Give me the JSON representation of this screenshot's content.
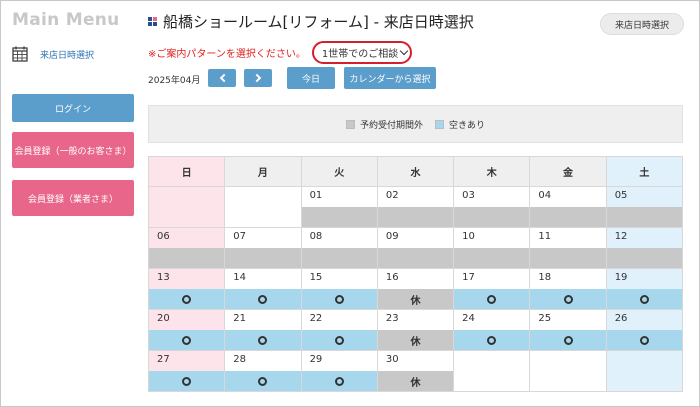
{
  "sidebar": {
    "menu_title": "Main Menu",
    "visit_link": "来店日時選択",
    "login": "ログイン",
    "register_general": "会員登録（一般のお客さま）",
    "register_business": "会員登録（業者さま）"
  },
  "header": {
    "title": "船橋ショールーム[リフォーム] - 来店日時選択",
    "badge": "来店日時選択",
    "pattern_notice": "※ご案内パターンを選択ください。",
    "pattern_selected": "1世帯でのご相談"
  },
  "nav": {
    "month": "2025年04月",
    "today": "今日",
    "pick_calendar": "カレンダーから選択"
  },
  "legend": {
    "closed_label": "予約受付期間外",
    "open_label": "空きあり"
  },
  "colors": {
    "accent_blue": "#5b9dcb",
    "accent_pink": "#e8668a",
    "closed_gray": "#c8c8c8",
    "open_blue": "#a6d7ec"
  },
  "calendar": {
    "weekdays": [
      "日",
      "月",
      "火",
      "水",
      "木",
      "金",
      "土"
    ],
    "weeks": [
      [
        {
          "d": "",
          "s": ""
        },
        {
          "d": "",
          "s": ""
        },
        {
          "d": "01",
          "s": "closed"
        },
        {
          "d": "02",
          "s": "closed"
        },
        {
          "d": "03",
          "s": "closed"
        },
        {
          "d": "04",
          "s": "closed"
        },
        {
          "d": "05",
          "s": "closed"
        }
      ],
      [
        {
          "d": "06",
          "s": "closed"
        },
        {
          "d": "07",
          "s": "closed"
        },
        {
          "d": "08",
          "s": "closed"
        },
        {
          "d": "09",
          "s": "closed"
        },
        {
          "d": "10",
          "s": "closed"
        },
        {
          "d": "11",
          "s": "closed"
        },
        {
          "d": "12",
          "s": "closed"
        }
      ],
      [
        {
          "d": "13",
          "s": "open"
        },
        {
          "d": "14",
          "s": "open"
        },
        {
          "d": "15",
          "s": "open"
        },
        {
          "d": "16",
          "s": "holiday"
        },
        {
          "d": "17",
          "s": "open"
        },
        {
          "d": "18",
          "s": "open"
        },
        {
          "d": "19",
          "s": "open"
        }
      ],
      [
        {
          "d": "20",
          "s": "open"
        },
        {
          "d": "21",
          "s": "open"
        },
        {
          "d": "22",
          "s": "open"
        },
        {
          "d": "23",
          "s": "holiday"
        },
        {
          "d": "24",
          "s": "open"
        },
        {
          "d": "25",
          "s": "open"
        },
        {
          "d": "26",
          "s": "open"
        }
      ],
      [
        {
          "d": "27",
          "s": "open"
        },
        {
          "d": "28",
          "s": "open"
        },
        {
          "d": "29",
          "s": "open"
        },
        {
          "d": "30",
          "s": "holiday"
        },
        {
          "d": "",
          "s": ""
        },
        {
          "d": "",
          "s": ""
        },
        {
          "d": "",
          "s": ""
        }
      ]
    ],
    "holiday_label": "休"
  }
}
